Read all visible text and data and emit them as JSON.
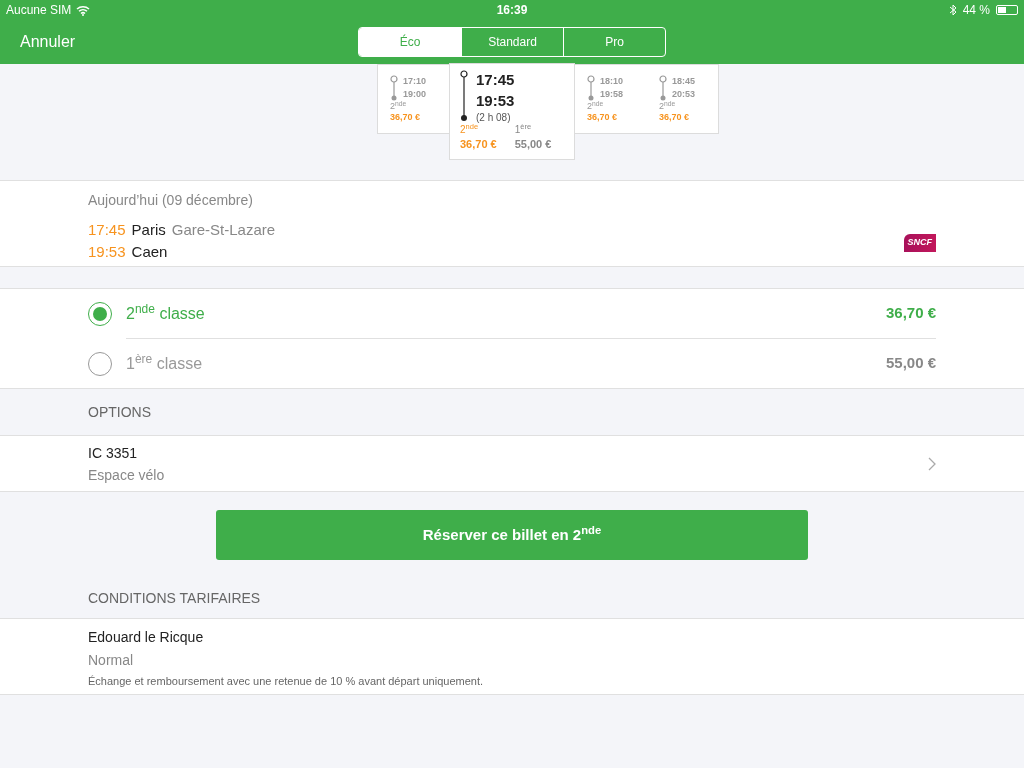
{
  "status_bar": {
    "carrier": "Aucune SIM",
    "time": "16:39",
    "battery": "44 %"
  },
  "nav": {
    "cancel": "Annuler",
    "tabs": [
      {
        "label": "Éco",
        "selected": true
      },
      {
        "label": "Standard",
        "selected": false
      },
      {
        "label": "Pro",
        "selected": false
      }
    ]
  },
  "trains": [
    {
      "departure": "17:10",
      "arrival": "19:00",
      "selected": false,
      "fares": [
        {
          "class": "2$^{nde}$",
          "price": "36,70 €"
        }
      ]
    },
    {
      "departure": "17:45",
      "arrival": "19:53",
      "duration": "(2 h 08)",
      "selected": true,
      "fares": [
        {
          "class": "2$^{nde}$",
          "price": "36,70 €",
          "selected": true
        },
        {
          "class": "1$^{ère}$",
          "price": "55,00 €",
          "selected": false
        }
      ]
    },
    {
      "departure": "18:10",
      "arrival": "19:58",
      "selected": false,
      "fares": [
        {
          "class": "2$^{nde}$",
          "price": "36,70 €"
        }
      ]
    },
    {
      "departure": "18:45",
      "arrival": "20:53",
      "selected": false,
      "fares": [
        {
          "class": "2$^{nde}$",
          "price": "36,70 €"
        }
      ]
    }
  ],
  "journey": {
    "date": "Aujourd’hui (09 décembre)",
    "stops": [
      {
        "time": "17:45",
        "city": "Paris",
        "station": "Gare-St-Lazare"
      },
      {
        "time": "19:53",
        "city": "Caen"
      }
    ],
    "operator_logo": "SNCF"
  },
  "classes": [
    {
      "label": "2$^{nde}$ classe",
      "price": "36,70 €",
      "selected": true
    },
    {
      "label": "1$^{ère}$ classe",
      "price": "55,00 €",
      "selected": false
    }
  ],
  "options": {
    "header": "OPTIONS",
    "items": [
      {
        "title": "IC 3351",
        "subtitle": "Espace vélo"
      }
    ]
  },
  "book_button": "Réserver ce billet en 2$^{nde}$",
  "conditions": {
    "header": "CONDITIONS TARIFAIRES",
    "name": "Edouard le Ricque",
    "fare": "Normal",
    "note": "Échange et remboursement avec une retenue de 10 % avant départ uniquement."
  }
}
